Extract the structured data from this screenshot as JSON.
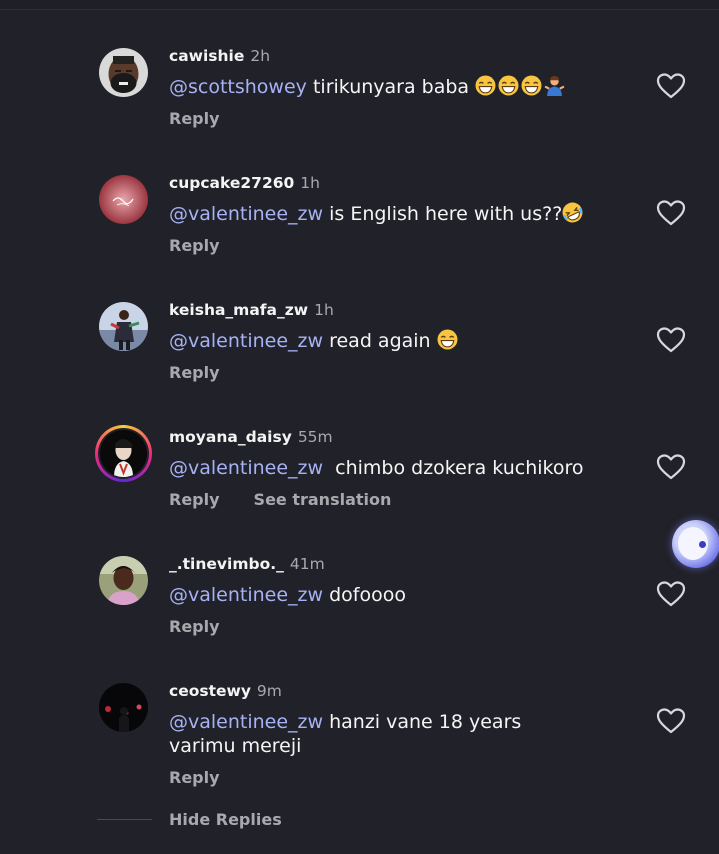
{
  "comments": [
    {
      "username": "cawishie",
      "time": "2h",
      "mention": "@scottshowey",
      "text": " tirikunyara baba",
      "emoji": [
        "grinning-face-smiling-eyes",
        "grinning-face-smiling-eyes",
        "grinning-face-smiling-eyes",
        "person-shrugging"
      ],
      "reply": "Reply",
      "avatar_icon": "avatar-cawishie"
    },
    {
      "username": "cupcake27260",
      "time": "1h",
      "mention": "@valentinee_zw",
      "text": " is English here with us??",
      "emoji": [
        "rolling-on-floor-laughing"
      ],
      "reply": "Reply",
      "avatar_icon": "avatar-cupcake27260"
    },
    {
      "username": "keisha_mafa_zw",
      "time": "1h",
      "mention": "@valentinee_zw",
      "text": " read again",
      "emoji": [
        "grinning-face-smiling-eyes"
      ],
      "reply": "Reply",
      "avatar_icon": "avatar-keisha"
    },
    {
      "username": "moyana_daisy",
      "time": "55m",
      "mention": "@valentinee_zw",
      "text": "  chimbo dzokera kuchikoro",
      "emoji": [],
      "reply": "Reply",
      "see_translation": "See translation",
      "avatar_icon": "avatar-moyana-story-ring"
    },
    {
      "username": "_.tinevimbo._",
      "time": "41m",
      "mention": "@valentinee_zw",
      "text": " dofoooo",
      "emoji": [],
      "reply": "Reply",
      "avatar_icon": "avatar-tinevimbo"
    },
    {
      "username": "ceostewy",
      "time": "9m",
      "mention": "@valentinee_zw",
      "text": " hanzi vane 18 years varimu mereji",
      "emoji": [],
      "reply": "Reply",
      "avatar_icon": "avatar-ceostewy"
    }
  ],
  "hide_replies": "Hide Replies",
  "icons": {
    "like": "heart-outline-icon",
    "floating": "assistant-bubble-icon"
  },
  "colors": {
    "background": "#212129",
    "mention": "#a7b2f5",
    "secondary_text": "#a8a8ad"
  }
}
